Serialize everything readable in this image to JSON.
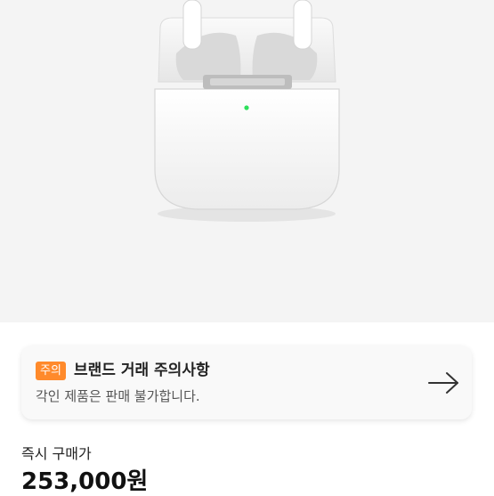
{
  "product": {
    "image_icon": "airpods-case-image"
  },
  "notice": {
    "badge": "주의",
    "title": "브랜드 거래 주의사항",
    "subtitle": "각인 제품은 판매 불가합니다.",
    "arrow_icon": "arrow-right-icon"
  },
  "price": {
    "label": "즉시 구매가",
    "value": "253,000원"
  },
  "colors": {
    "badge": "#ff8a2b",
    "hero_background": "#f4f4f4"
  }
}
